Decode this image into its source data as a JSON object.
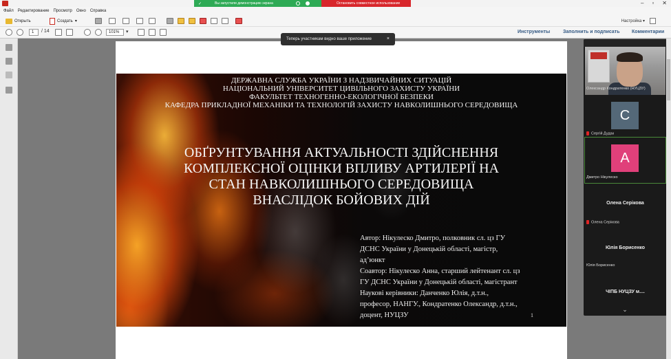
{
  "share_banner": {
    "notice": "Вы запустили демонстрацию экрана",
    "stop_label": "Остановить совместное использование"
  },
  "menu": {
    "items": [
      "Файл",
      "Редактирование",
      "Просмотр",
      "Окно",
      "Справка"
    ]
  },
  "toolbar": {
    "open_label": "Открыть",
    "create_label": "Создать",
    "settings_label": "Настройка"
  },
  "navbar": {
    "page_current": "1",
    "page_total": "/ 14",
    "zoom": "101%",
    "panels": [
      "Инструменты",
      "Заполнить и подписать",
      "Комментарии"
    ]
  },
  "tooltip": {
    "text": "Теперь участникам видно ваше приложение",
    "close": "×"
  },
  "slide": {
    "header_lines": [
      "ДЕРЖАВНА СЛУЖБА УКРАЇНИ З НАДЗВИЧАЙНИХ СИТУАЦІЙ",
      "НАЦІОНАЛЬНИЙ УНІВЕРСИТЕТ ЦИВІЛЬНОГО ЗАХИСТУ УКРАЇНИ",
      "ФАКУЛЬТЕТ ТЕХНОГЕННО-ЕКОЛОГІЧНОЇ БЕЗПЕКИ",
      "КАФЕДРА ПРИКЛАДНОЇ МЕХАНІКИ ТА ТЕХНОЛОГІЙ ЗАХИСТУ НАВКОЛИШНЬОГО СЕРЕДОВИЩА"
    ],
    "title_lines": [
      "ОБҐРУНТУВАННЯ АКТУАЛЬНОСТІ ЗДІЙСНЕННЯ",
      "КОМПЛЕКСНОЇ ОЦІНКИ ВПЛИВУ АРТИЛЕРІЇ НА",
      "СТАН НАВКОЛИШНЬОГО СЕРЕДОВИЩА",
      "ВНАСЛІДОК БОЙОВИХ ДІЙ"
    ],
    "author_lines": [
      "Автор: Нікулеско Дмитро, полковник сл. цз ГУ",
      "ДСНС України у Донецькій області, магістр,",
      "ад’юнкт",
      "Соавтор: Нікулеско Анна, старший лейтенант сл. цз",
      "ГУ ДСНС України у Донецькій області, магістрант",
      "Наукові керівники: Данченко Юлія, д.т.н.,",
      "професор, НАНГУ., Кондратенко Олександр, д.т.н.,",
      "доцент, НУЦЗУ"
    ],
    "page_number": "1"
  },
  "participants": [
    {
      "name": "Олександр Кондратенко (НУЦЗУ)",
      "type": "video"
    },
    {
      "name": "Сергій Дудак",
      "avatar": "С",
      "muted": true
    },
    {
      "name": "Дмитро Нікулеско",
      "avatar": "А",
      "muted": false
    },
    {
      "name": "Олена Серікова",
      "label": "Олена Серікова",
      "muted": true
    },
    {
      "name": "Юлія Борисенко",
      "label": "Юлія Борисенко",
      "muted": false
    },
    {
      "label": "ЧІПБ НУЦЗУ м...."
    }
  ],
  "colors": {
    "share_green": "#2eaa55",
    "share_red": "#d8262b",
    "panel_link": "#355a84",
    "avatar_c": "#546878",
    "avatar_a": "#e0407a"
  }
}
